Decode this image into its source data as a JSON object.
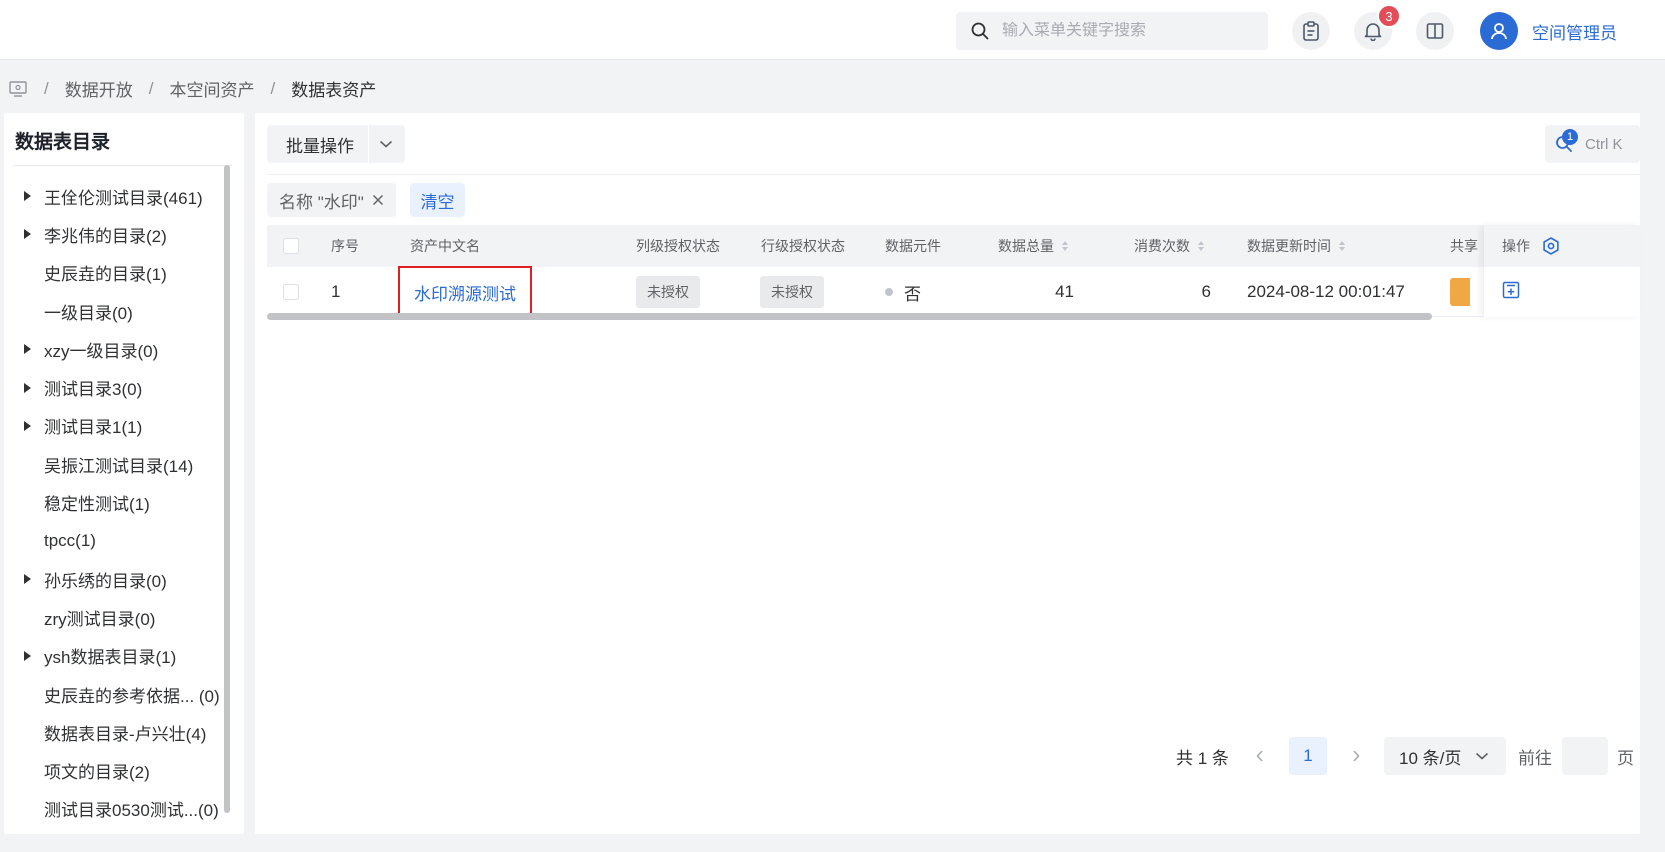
{
  "header": {
    "search_placeholder": "输入菜单关键字搜索",
    "notification_count": "3",
    "username": "空间管理员"
  },
  "breadcrumb": [
    "数据开放",
    "本空间资产",
    "数据表资产"
  ],
  "sidebar": {
    "title": "数据表目录",
    "items": [
      {
        "label": "王佺伦测试目录(461)",
        "expandable": true
      },
      {
        "label": "李兆伟的目录(2)",
        "expandable": true
      },
      {
        "label": "史辰垚的目录(1)",
        "expandable": false
      },
      {
        "label": "一级目录(0)",
        "expandable": false
      },
      {
        "label": "xzy一级目录(0)",
        "expandable": true
      },
      {
        "label": "测试目录3(0)",
        "expandable": true
      },
      {
        "label": "测试目录1(1)",
        "expandable": true
      },
      {
        "label": "吴振江测试目录(14)",
        "expandable": false
      },
      {
        "label": "稳定性测试(1)",
        "expandable": false
      },
      {
        "label": "tpcc(1)",
        "expandable": false
      },
      {
        "label": "孙乐绣的目录(0)",
        "expandable": true
      },
      {
        "label": "zry测试目录(0)",
        "expandable": false
      },
      {
        "label": "ysh数据表目录(1)",
        "expandable": true
      },
      {
        "label": "史辰垚的参考依据... (0)",
        "expandable": false
      },
      {
        "label": "数据表目录-卢兴壮(4)",
        "expandable": false
      },
      {
        "label": "项文的目录(2)",
        "expandable": false
      },
      {
        "label": "测试目录0530测试...(0)",
        "expandable": false
      }
    ]
  },
  "toolbar": {
    "batch_label": "批量操作",
    "search_badge": "1",
    "shortcut": "Ctrl K"
  },
  "filter": {
    "tag": "名称 \"水印\"",
    "clear": "清空"
  },
  "table": {
    "columns": {
      "index": "序号",
      "name": "资产中文名",
      "col_auth": "列级授权状态",
      "row_auth": "行级授权状态",
      "data_element": "数据元件",
      "total": "数据总量",
      "consume": "消费次数",
      "updated": "数据更新时间",
      "share": "共享",
      "actions": "操作"
    },
    "rows": [
      {
        "index": "1",
        "name": "水印溯源测试",
        "col_auth": "未授权",
        "row_auth": "未授权",
        "data_element": "否",
        "total": "41",
        "consume": "6",
        "updated": "2024-08-12 00:01:47"
      }
    ]
  },
  "pagination": {
    "total": "共 1 条",
    "current": "1",
    "page_size": "10 条/页",
    "goto_prefix": "前往",
    "goto_suffix": "页"
  },
  "colors": {
    "primary": "#2b6bd6",
    "badge": "#e34d59",
    "highlight_border": "#e02020",
    "share_tag": "#f0a844"
  }
}
